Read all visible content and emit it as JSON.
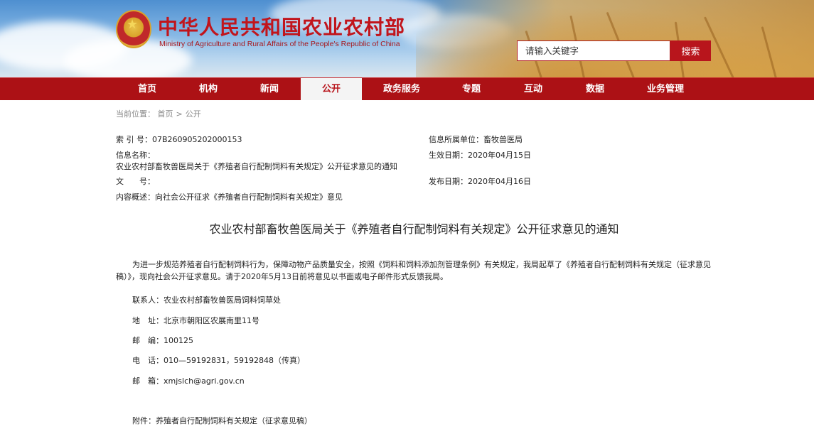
{
  "header": {
    "title": "中华人民共和国农业农村部",
    "subtitle": "Ministry of Agriculture and Rural Affairs of the People's Republic of China",
    "emblem_icon": "national-emblem-icon",
    "colors": {
      "brand_red": "#b8151c",
      "nav_red": "#ac1115",
      "title_red": "#c1151c"
    }
  },
  "search": {
    "placeholder": "请输入关键字",
    "button_label": "搜索"
  },
  "nav": {
    "items": [
      {
        "label": "首页"
      },
      {
        "label": "机构"
      },
      {
        "label": "新闻"
      },
      {
        "label": "公开",
        "active": true
      },
      {
        "label": "政务服务"
      },
      {
        "label": "专题"
      },
      {
        "label": "互动"
      },
      {
        "label": "数据"
      },
      {
        "label": "业务管理"
      }
    ]
  },
  "breadcrumb": {
    "prefix": "当前位置：",
    "items": [
      "首页",
      "公开"
    ],
    "separator": ">"
  },
  "meta": {
    "index_label": "索 引 号：",
    "index_value": "07B260905202000153",
    "unit_label": "信息所属单位：",
    "unit_value": "畜牧兽医局",
    "name_label": "信息名称：",
    "name_value": "农业农村部畜牧兽医局关于《养殖者自行配制饲料有关规定》公开征求意见的通知",
    "effective_label": "生效日期：",
    "effective_value": "2020年04月15日",
    "docno_label": "文　　号：",
    "docno_value": "",
    "publish_label": "发布日期：",
    "publish_value": "2020年04月16日",
    "summary_label": "内容概述：",
    "summary_value": "向社会公开征求《养殖者自行配制饲料有关规定》意见"
  },
  "article": {
    "title": "农业农村部畜牧兽医局关于《养殖者自行配制饲料有关规定》公开征求意见的通知",
    "paragraph": "为进一步规范养殖者自行配制饲料行为，保障动物产品质量安全，按照《饲料和饲料添加剂管理条例》有关规定，我局起草了《养殖者自行配制饲料有关规定（征求意见稿）》，现向社会公开征求意见。请于2020年5月13日前将意见以书面或电子邮件形式反馈我局。",
    "contact_label": "联系人：",
    "contact_value": "农业农村部畜牧兽医局饲料饲草处",
    "address_label": "地　址：",
    "address_value": "北京市朝阳区农展南里11号",
    "postcode_label": "邮　编：",
    "postcode_value": "100125",
    "phone_label": "电　话：",
    "phone_value": "010—59192831，59192848（传真）",
    "email_label": "邮　箱：",
    "email_value": "xmjslch@agri.gov.cn",
    "attachment_label": "附件：",
    "attachment_value": "养殖者自行配制饲料有关规定（征求意见稿）"
  }
}
